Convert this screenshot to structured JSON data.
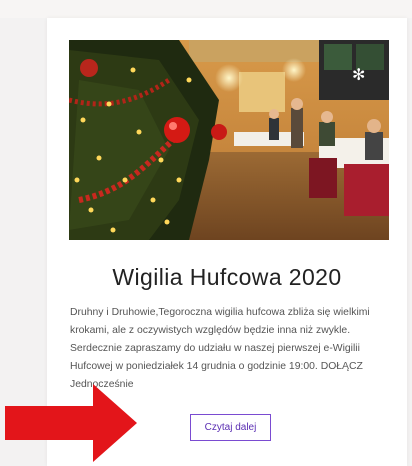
{
  "header": {
    "text": ""
  },
  "post": {
    "image_alt": "Wigilia Hufcowa - dekorowana choinka w sali",
    "title": "Wigilia Hufcowa 2020",
    "excerpt": "Druhny i Druhowie,Tegoroczna wigilia hufcowa zbliża się wielkimi krokami, ale z oczywistych względów będzie inna niż zwykle. Serdecznie zapraszamy do udziału w naszej pierwszej e-Wigilii Hufcowej w poniedziałek 14 grudnia o godzinie 19:00. DOŁĄCZ Jednocześnie",
    "read_more": "Czytaj dalej"
  },
  "colors": {
    "accent": "#7a4bd1",
    "arrow": "#e3151a"
  }
}
